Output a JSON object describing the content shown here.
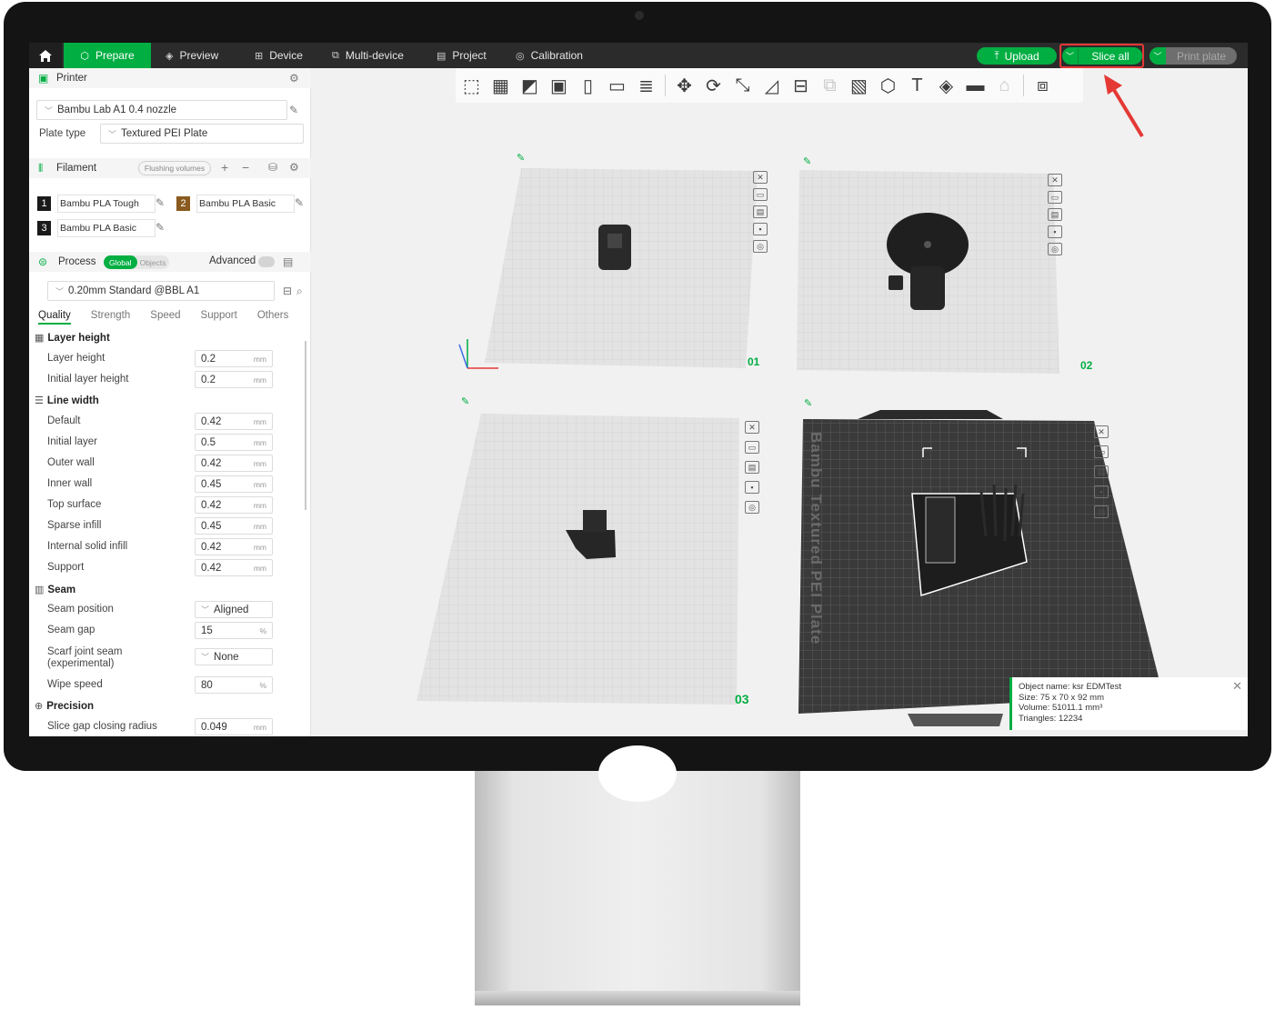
{
  "topbar": {
    "tabs": [
      {
        "label": "Prepare",
        "icon": "cube-icon"
      },
      {
        "label": "Preview",
        "icon": "layers-icon"
      },
      {
        "label": "Device",
        "icon": "device-icon"
      },
      {
        "label": "Multi-device",
        "icon": "multi-device-icon"
      },
      {
        "label": "Project",
        "icon": "project-icon"
      },
      {
        "label": "Calibration",
        "icon": "calibration-icon"
      }
    ],
    "upload_label": "Upload",
    "slice_label": "Slice all",
    "print_label": "Print plate"
  },
  "printer": {
    "section_label": "Printer",
    "selected": "Bambu Lab A1 0.4 nozzle",
    "plate_type_label": "Plate type",
    "plate_type": "Textured PEI Plate"
  },
  "filament": {
    "section_label": "Filament",
    "flushing_label": "Flushing volumes",
    "items": [
      {
        "num": "1",
        "name": "Bambu PLA Tough",
        "color": "#1a1a1a"
      },
      {
        "num": "2",
        "name": "Bambu PLA Basic",
        "color": "#8a5a1e"
      },
      {
        "num": "3",
        "name": "Bambu PLA Basic",
        "color": "#1a1a1a"
      }
    ]
  },
  "process": {
    "section_label": "Process",
    "toggle_global": "Global",
    "toggle_objects": "Objects",
    "advanced_label": "Advanced",
    "preset": "0.20mm Standard @BBL A1",
    "tabs": [
      "Quality",
      "Strength",
      "Speed",
      "Support",
      "Others"
    ]
  },
  "quality": {
    "layer_height_group": "Layer height",
    "layer_height": {
      "label": "Layer height",
      "value": "0.2",
      "unit": "mm"
    },
    "initial_layer_height": {
      "label": "Initial layer height",
      "value": "0.2",
      "unit": "mm"
    },
    "line_width_group": "Line width",
    "line_widths": [
      {
        "label": "Default",
        "value": "0.42",
        "unit": "mm"
      },
      {
        "label": "Initial layer",
        "value": "0.5",
        "unit": "mm"
      },
      {
        "label": "Outer wall",
        "value": "0.42",
        "unit": "mm"
      },
      {
        "label": "Inner wall",
        "value": "0.45",
        "unit": "mm"
      },
      {
        "label": "Top surface",
        "value": "0.42",
        "unit": "mm"
      },
      {
        "label": "Sparse infill",
        "value": "0.45",
        "unit": "mm"
      },
      {
        "label": "Internal solid infill",
        "value": "0.42",
        "unit": "mm"
      },
      {
        "label": "Support",
        "value": "0.42",
        "unit": "mm"
      }
    ],
    "seam_group": "Seam",
    "seam_position": {
      "label": "Seam position",
      "value": "Aligned"
    },
    "seam_gap": {
      "label": "Seam gap",
      "value": "15",
      "unit": "%"
    },
    "scarf": {
      "label": "Scarf joint seam (experimental)",
      "value": "None"
    },
    "wipe_speed": {
      "label": "Wipe speed",
      "value": "80",
      "unit": "%"
    },
    "precision_group": "Precision",
    "slice_gap": {
      "label": "Slice gap closing radius",
      "value": "0.049",
      "unit": "mm"
    }
  },
  "plates": [
    {
      "num": "01"
    },
    {
      "num": "02"
    },
    {
      "num": "03"
    },
    {
      "num": "",
      "label": "Bambu Textured PEI Plate"
    }
  ],
  "object_info": {
    "name": "Object name: ksr EDMTest",
    "size": "Size: 75 x 70 x 92 mm",
    "volume": "Volume: 51011.1 mm³",
    "triangles": "Triangles: 12234"
  }
}
